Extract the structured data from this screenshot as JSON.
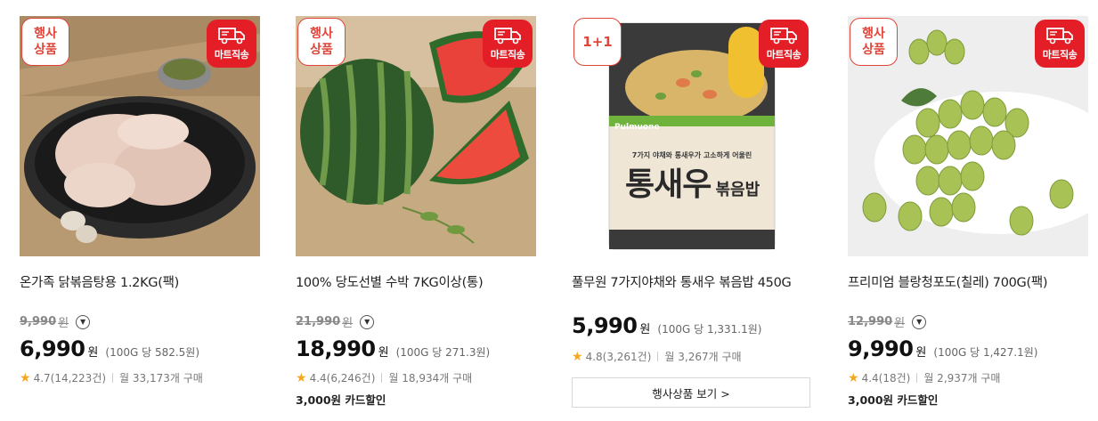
{
  "colors": {
    "accent_red": "#e41e26",
    "star": "#f5a623"
  },
  "products": [
    {
      "badge": "행사\n상품",
      "delivery_badge": "마트직송",
      "name": "온가족 닭볶음탕용 1.2KG(팩)",
      "original_price": "9,990",
      "original_won": "원",
      "price": "6,990",
      "price_won": "원",
      "unit_price": "(100G 당 582.5원)",
      "rating": "4.7(14,223건)",
      "monthly": "월 33,173개 구매",
      "discount": "",
      "icon_info": "chevron-down-circle-icon"
    },
    {
      "badge": "행사\n상품",
      "delivery_badge": "마트직송",
      "name": "100% 당도선별 수박 7KG이상(통)",
      "original_price": "21,990",
      "original_won": "원",
      "price": "18,990",
      "price_won": "원",
      "unit_price": "(100G 당 271.3원)",
      "rating": "4.4(6,246건)",
      "monthly": "월 18,934개 구매",
      "discount": "3,000원 카드할인"
    },
    {
      "badge": "1+1",
      "delivery_badge": "마트직송",
      "name": "풀무원 7가지야채와 통새우 볶음밥 450G",
      "price": "5,990",
      "price_won": "원",
      "unit_price": "(100G 당 1,331.1원)",
      "rating": "4.8(3,261건)",
      "monthly": "월 3,267개 구매",
      "event_button": "행사상품 보기 >",
      "package": {
        "brand": "Pulmuone",
        "tagline": "7가지 야채와 통새우가 고소하게 어울린",
        "title_main": "통새우",
        "title_sub": "볶음밥"
      }
    },
    {
      "badge": "행사\n상품",
      "delivery_badge": "마트직송",
      "name": "프리미엄 블랑청포도(칠레) 700G(팩)",
      "original_price": "12,990",
      "original_won": "원",
      "price": "9,990",
      "price_won": "원",
      "unit_price": "(100G 당 1,427.1원)",
      "rating": "4.4(18건)",
      "monthly": "월 2,937개 구매",
      "discount": "3,000원 카드할인"
    }
  ]
}
